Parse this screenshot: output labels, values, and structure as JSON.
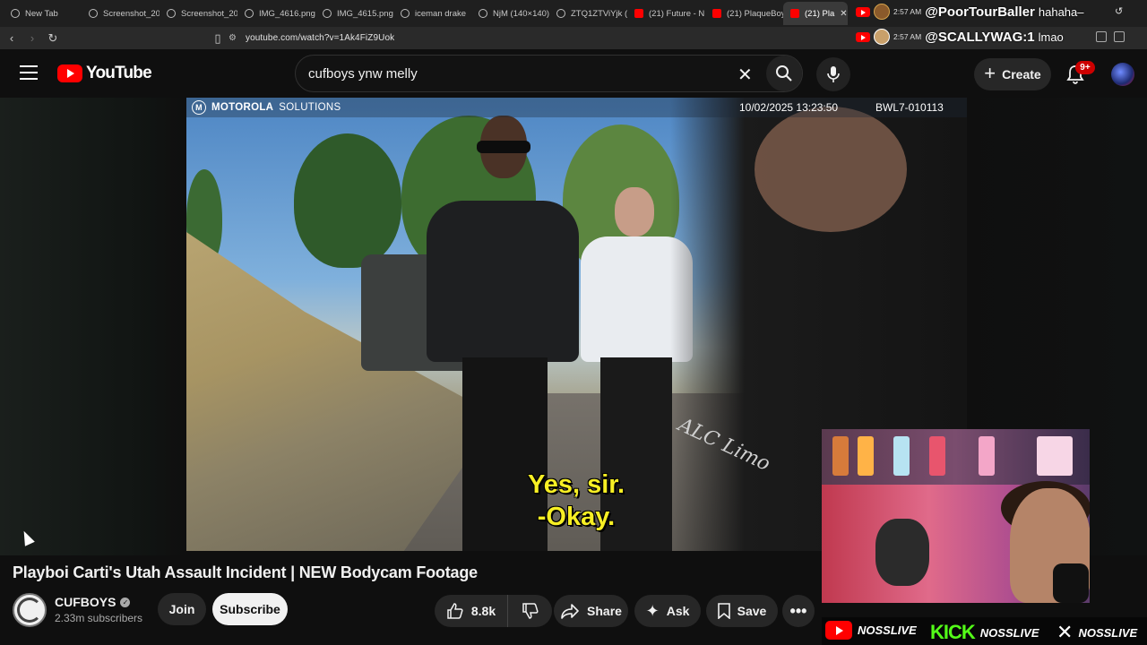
{
  "browser": {
    "tabs": [
      {
        "title": "New Tab",
        "icon": "web-icon"
      },
      {
        "title": "Screenshot_20",
        "icon": "web-icon"
      },
      {
        "title": "Screenshot_20",
        "icon": "web-icon"
      },
      {
        "title": "IMG_4616.png",
        "icon": "web-icon"
      },
      {
        "title": "IMG_4615.png",
        "icon": "web-icon"
      },
      {
        "title": "iceman drake",
        "icon": "web-icon"
      },
      {
        "title": "NjM (140×140)",
        "icon": "web-icon"
      },
      {
        "title": "ZTQ1ZTViYjk (",
        "icon": "web-icon"
      },
      {
        "title": "(21) Future - N",
        "icon": "youtube-icon"
      },
      {
        "title": "(21) PlaqueBoy",
        "icon": "youtube-icon"
      }
    ],
    "active_tab": {
      "title": "(21) Pla"
    },
    "url": "youtube.com/watch?v=1Ak4FiZ9Uok"
  },
  "stream_chat": [
    {
      "time": "2:57 AM",
      "user": "@PoorTourBaller",
      "message": "hahaha–"
    },
    {
      "time": "2:57 AM",
      "user": "@SCALLYWAG:1",
      "message": "lmao"
    }
  ],
  "youtube": {
    "logo_text": "YouTube",
    "search_query": "cufboys ynw melly",
    "create_label": "Create",
    "notification_count": "9+"
  },
  "video": {
    "bodycam_brand": "MOTOROLA",
    "bodycam_brand_suffix": "SOLUTIONS",
    "bodycam_timestamp": "10/02/2025 13:23:50",
    "bodycam_id": "BWL7-010113",
    "door_text": "ALC Limo",
    "subtitle_line1": "Yes, sir.",
    "subtitle_line2": "-Okay.",
    "title": "Playboi Carti's Utah Assault Incident | NEW Bodycam Footage"
  },
  "channel": {
    "name": "CUFBOYS",
    "subscribers": "2.33m subscribers"
  },
  "actions": {
    "join": "Join",
    "subscribe": "Subscribe",
    "likes": "8.8k",
    "share": "Share",
    "ask": "Ask",
    "save": "Save"
  },
  "socials": [
    {
      "platform": "youtube-icon",
      "handle": "NOSSLIVE"
    },
    {
      "platform": "KICK",
      "handle": "NOSSLIVE"
    },
    {
      "platform": "x-icon",
      "handle": "NOSSLIVE"
    }
  ],
  "colors": {
    "youtube_red": "#ff0000",
    "subtitle_yellow": "#f7ef24",
    "kick_green": "#53fc18",
    "background": "#0f0f0f"
  }
}
